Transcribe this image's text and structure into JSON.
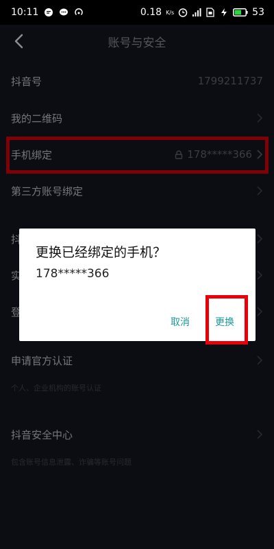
{
  "status_bar": {
    "time": "10:11",
    "network_speed": "0.18",
    "speed_unit": "K/s",
    "battery": "53",
    "left_icons": [
      "message-icon",
      "chat-icon",
      "hotspot-icon"
    ],
    "right_icons": [
      "alarm-icon",
      "signal-icon",
      "sim-icon",
      "charging-icon",
      "battery-icon"
    ]
  },
  "nav": {
    "title": "账号与安全"
  },
  "settings": {
    "douyin_id_label": "抖音号",
    "douyin_id_value": "1799211737",
    "qrcode_label": "我的二维码",
    "phone_label": "手机绑定",
    "phone_value": "178*****366",
    "third_party_label": "第三方账号绑定",
    "row5_partial": "抖",
    "row6_partial": "实",
    "row7_partial": "登",
    "official_verify_label": "申请官方认证",
    "official_verify_sub": "个人、企业机构的账号认证",
    "security_center_label": "抖音安全中心",
    "security_center_sub": "包含账号信息泄露、诈骗等账号问题"
  },
  "dialog": {
    "title": "更换已经绑定的手机？",
    "message": "178*****366",
    "cancel_label": "取消",
    "confirm_label": "更换"
  },
  "colors": {
    "background": "#161823",
    "highlight": "#e8000b",
    "dialog_button": "#1c9a9a"
  }
}
